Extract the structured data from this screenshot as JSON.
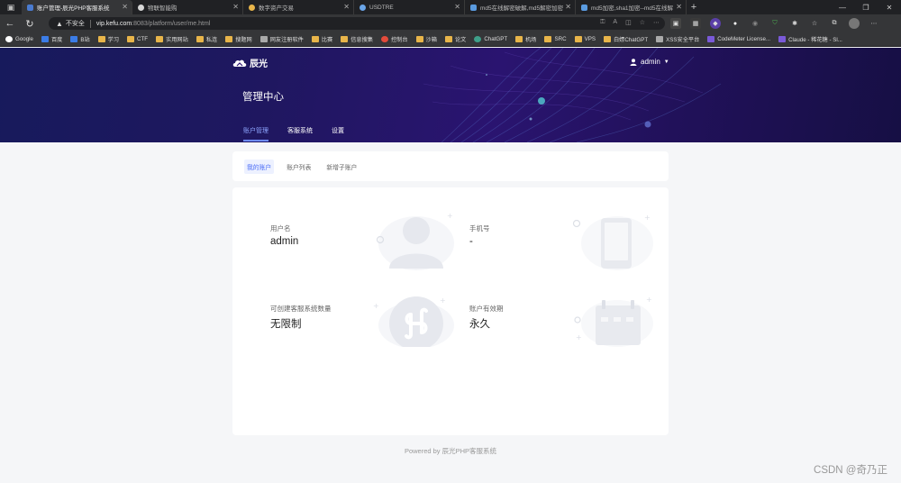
{
  "browser": {
    "tabs": [
      {
        "title": "账户管理-辰光PHP客服系统",
        "color": "#4a7bd0",
        "active": true
      },
      {
        "title": "物联智能购",
        "color": "#d7d7d7",
        "active": false
      },
      {
        "title": "数字资产交易",
        "color": "#e8b54a",
        "active": false
      },
      {
        "title": "USDTRE",
        "color": "#6aa5e8",
        "active": false
      },
      {
        "title": "md5在线解密破解,md5解密加密",
        "color": "#5a9be0",
        "active": false
      },
      {
        "title": "md5加密,sha1加密--md5在线解",
        "color": "#5a9be0",
        "active": false
      }
    ],
    "address": {
      "security_label": "不安全",
      "host": "vip.kefu.com",
      "path": ":8083/platform/user/me.html"
    },
    "bookmarks": [
      {
        "label": "Google",
        "icon": "g"
      },
      {
        "label": "百度",
        "icon": "b"
      },
      {
        "label": "B站",
        "icon": "b"
      },
      {
        "label": "学习",
        "icon": "folder"
      },
      {
        "label": "CTF",
        "icon": "folder"
      },
      {
        "label": "实用网站",
        "icon": "folder"
      },
      {
        "label": "私连",
        "icon": "folder"
      },
      {
        "label": "搜题网",
        "icon": "folder"
      },
      {
        "label": "网友注册软件",
        "icon": "gray"
      },
      {
        "label": "比赛",
        "icon": "folder"
      },
      {
        "label": "信息搜集",
        "icon": "folder"
      },
      {
        "label": "控制台",
        "icon": "red"
      },
      {
        "label": "沙箱",
        "icon": "folder"
      },
      {
        "label": "论文",
        "icon": "folder"
      },
      {
        "label": "ChatGPT",
        "icon": "teal"
      },
      {
        "label": "机场",
        "icon": "folder"
      },
      {
        "label": "SRC",
        "icon": "folder"
      },
      {
        "label": "VPS",
        "icon": "folder"
      },
      {
        "label": "白嫖ChatGPT",
        "icon": "folder"
      },
      {
        "label": "XSS安全平台",
        "icon": "gray"
      },
      {
        "label": "CodeMeter License...",
        "icon": "purple"
      },
      {
        "label": "Claude - 稀花糖 - Sl...",
        "icon": "purple"
      }
    ]
  },
  "header": {
    "logo_text": "辰光",
    "user_name": "admin",
    "title": "管理中心",
    "tabs": [
      {
        "label": "账户管理",
        "active": true
      },
      {
        "label": "客服系统",
        "active": false
      },
      {
        "label": "设置",
        "active": false
      }
    ]
  },
  "subnav": {
    "tabs": [
      {
        "label": "我的账户",
        "active": true
      },
      {
        "label": "账户列表",
        "active": false
      },
      {
        "label": "新增子账户",
        "active": false
      }
    ]
  },
  "account": {
    "username": {
      "label": "用户名",
      "value": "admin",
      "icon": "user-icon"
    },
    "phone": {
      "label": "手机号",
      "value": "-",
      "icon": "phone-icon"
    },
    "quota": {
      "label": "可创建客服系统数量",
      "value": "无限制",
      "icon": "miniprogram-icon"
    },
    "validity": {
      "label": "账户有效期",
      "value": "永久",
      "icon": "calendar-icon"
    }
  },
  "footer": {
    "text": "Powered by 辰光PHP客服系统"
  },
  "watermark": "CSDN @奇乃正",
  "colors": {
    "accent": "#4a6cf7",
    "hero_dark": "#1f1760",
    "page_bg": "#f5f6f8"
  }
}
